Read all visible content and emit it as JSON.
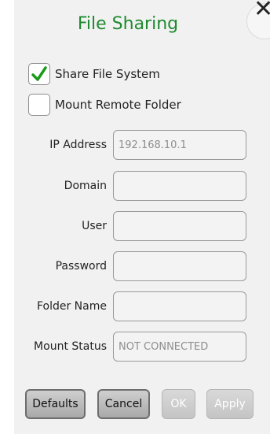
{
  "dialog": {
    "title": "File Sharing",
    "close_glyph": "✕"
  },
  "options": {
    "share_file_system": {
      "label": "Share File System",
      "checked": true
    },
    "mount_remote_folder": {
      "label": "Mount Remote Folder",
      "checked": false
    }
  },
  "fields": {
    "ip_address": {
      "label": "IP Address",
      "value": "192.168.10.1"
    },
    "domain": {
      "label": "Domain",
      "value": ""
    },
    "user": {
      "label": "User",
      "value": ""
    },
    "password": {
      "label": "Password",
      "value": ""
    },
    "folder_name": {
      "label": "Folder Name",
      "value": ""
    },
    "mount_status": {
      "label": "Mount Status",
      "value": "NOT CONNECTED"
    }
  },
  "buttons": {
    "defaults": "Defaults",
    "cancel": "Cancel",
    "ok": "OK",
    "apply": "Apply"
  },
  "colors": {
    "title": "#1e8a2e",
    "checkmark": "#1a9a1a"
  },
  "icons": {
    "close": "close-icon",
    "check": "checkmark-icon"
  }
}
